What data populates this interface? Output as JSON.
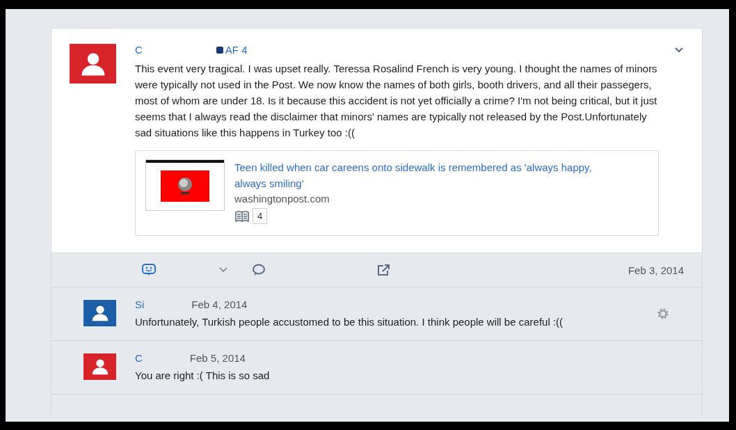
{
  "post": {
    "author": "C",
    "badge": "AF 4",
    "color": "#d9232a",
    "text": "This event very tragical. I was upset really. Teressa Rosalind French is very young. I thought the names of minors were typically not used in the Post. We now know the names of both girls, booth drivers, and all their passegers, most of whom are under 18. Is it because this accident is not yet officially a crime? I'm not being critical, but it just seems that I always read the disclaimer that minors' names are typically not released by the Post.Unfortunately sad situations like this happens in Turkey too :((",
    "link": {
      "kind": "picture",
      "title": "Teen killed when car careens onto sidewalk is remembered as 'always happy, always smiling'",
      "domain": "washingtonpost.com",
      "count": "4"
    },
    "date": "Feb 3, 2014"
  },
  "replies": [
    {
      "author": "Si",
      "date": "Feb 4, 2014",
      "text": "Unfortunately, Turkish people accustomed to be this situation. I think people will be careful :((",
      "color": "#1c5ea8",
      "settings_icon": true
    },
    {
      "author": "C",
      "date": "Feb 5, 2014",
      "text": "You are right :( This is so sad",
      "color": "#d9232a",
      "settings_icon": false
    }
  ]
}
